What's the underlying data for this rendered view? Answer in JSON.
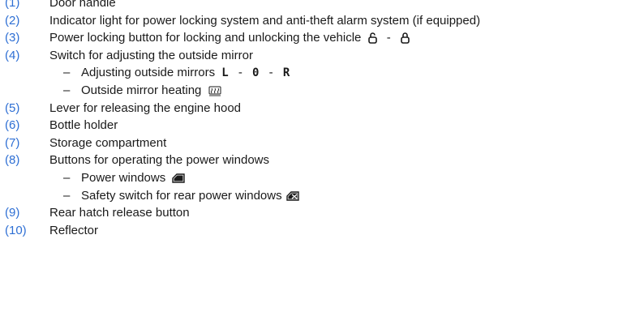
{
  "items": [
    {
      "num": "(1)",
      "text": "Door handle"
    },
    {
      "num": "(2)",
      "text": "Indicator light for power locking system and anti-theft alarm system (if equipped)"
    },
    {
      "num": "(3)",
      "text": "Power locking button for locking and unlocking the vehicle"
    },
    {
      "num": "(4)",
      "text": "Switch for adjusting the outside mirror"
    },
    {
      "num": "(5)",
      "text": "Lever for releasing the engine hood"
    },
    {
      "num": "(6)",
      "text": "Bottle holder"
    },
    {
      "num": "(7)",
      "text": "Storage compartment"
    },
    {
      "num": "(8)",
      "text": "Buttons for operating the power windows"
    },
    {
      "num": "(9)",
      "text": "Rear hatch release button"
    },
    {
      "num": "(10)",
      "text": "Reflector"
    }
  ],
  "sub4": [
    {
      "text": "Adjusting outside mirrors"
    },
    {
      "text": "Outside mirror heating"
    }
  ],
  "sub8": [
    {
      "text": "Power windows"
    },
    {
      "text": "Safety switch for rear power windows"
    }
  ],
  "dash": "–",
  "separator": "-",
  "mirror_positions": [
    "L",
    "0",
    "R"
  ],
  "icons": {
    "unlock": "unlock-icon",
    "lock": "lock-icon",
    "heating": "mirror-heating-icon",
    "window": "power-window-icon",
    "safety": "window-safety-switch-icon"
  },
  "colors": {
    "number": "#2e6fd4",
    "text": "#1a1a1a"
  }
}
